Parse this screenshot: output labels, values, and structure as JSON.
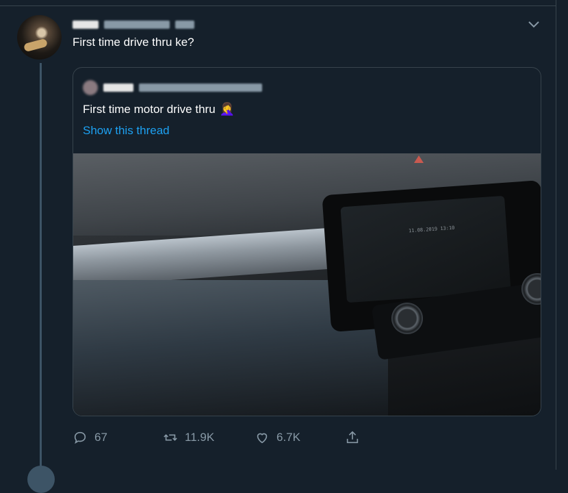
{
  "tweet": {
    "text": "First time drive thru ke?",
    "author_blurred": true
  },
  "quoted_tweet": {
    "text": "First time motor drive thru",
    "emoji": "🤦‍♀️",
    "show_thread_label": "Show this thread",
    "link_color": "#1da1f2",
    "image": {
      "description_shown": false,
      "screen_timestamp": "11.08.2019  13:10"
    }
  },
  "actions": {
    "reply_count": "67",
    "retweet_count": "11.9K",
    "like_count": "6.7K"
  },
  "icons": {
    "menu": "chevron-down-icon",
    "reply": "reply-icon",
    "retweet": "retweet-icon",
    "like": "heart-icon",
    "share": "share-icon"
  },
  "colors": {
    "background": "#15202b",
    "border": "#38444d",
    "muted_text": "#8899a6",
    "thread_line": "#3d5466"
  }
}
